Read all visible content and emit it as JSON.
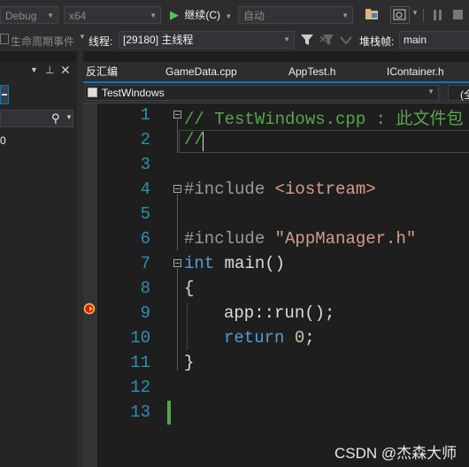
{
  "toolbar": {
    "config": "Debug",
    "platform": "x64",
    "continue_label": "继续(C)",
    "auto_combo": "自动"
  },
  "debugbar": {
    "lifecycle_label": "生命周期事件",
    "thread_label": "线程:",
    "thread_value": "[29180] 主线程",
    "stackframe_label": "堆栈帧:",
    "stackframe_value": "main"
  },
  "left_panel": {
    "search_icon": "magnifier-icon",
    "row_text": "0"
  },
  "tabs": [
    "反汇编",
    "GameData.cpp",
    "AppTest.h",
    "IContainer.h"
  ],
  "navbar": {
    "project": "TestWindows",
    "scope": "(全"
  },
  "editor": {
    "line_numbers": [
      "1",
      "2",
      "3",
      "4",
      "5",
      "6",
      "7",
      "8",
      "9",
      "10",
      "11",
      "12",
      "13"
    ],
    "lines": {
      "l1": "// TestWindows.cpp : 此文件包",
      "l2": "//",
      "l4_pp": "#include ",
      "l4_hdr": "<iostream>",
      "l6_pp": "#include ",
      "l6_hdr": "\"AppManager.h\"",
      "l7_kw": "int",
      "l7_rest": " main()",
      "l8": "{",
      "l9": "app::run();",
      "l10_kw": "return",
      "l10_sp": " ",
      "l10_num": "0",
      "l10_end": ";",
      "l11": "}"
    }
  },
  "watermark": "CSDN @杰森大师",
  "colors": {
    "accent": "#007acc",
    "line_number": "#2b91af",
    "comment": "#57a64a",
    "keyword": "#569cd6",
    "string": "#d69d85",
    "continue_green": "#4ec94e"
  }
}
